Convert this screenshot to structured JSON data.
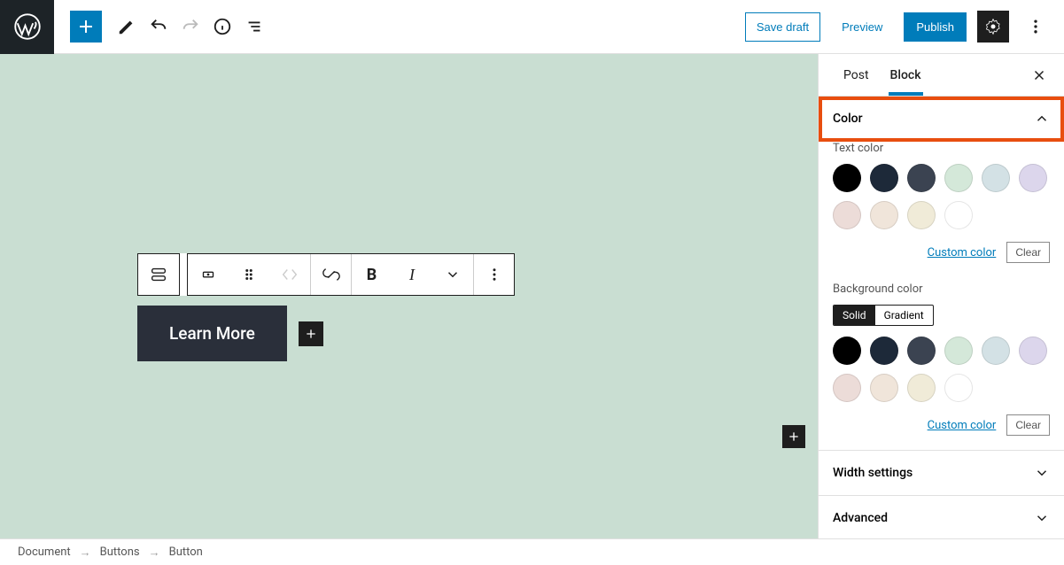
{
  "topbar": {
    "save_draft": "Save draft",
    "preview": "Preview",
    "publish": "Publish"
  },
  "sidebar": {
    "tabs": {
      "post": "Post",
      "block": "Block"
    },
    "panels": {
      "color": {
        "title": "Color",
        "text_label": "Text color",
        "bg_label": "Background color",
        "custom": "Custom color",
        "clear": "Clear",
        "bg_tabs": {
          "solid": "Solid",
          "gradient": "Gradient"
        },
        "swatches": [
          "#000000",
          "#1d2939",
          "#3b4351",
          "#d4e8d9",
          "#d3e1e5",
          "#dcd6ec",
          "#ecdcd8",
          "#f0e5da",
          "#f0ebd8",
          "#ffffff"
        ]
      },
      "width": {
        "title": "Width settings"
      },
      "advanced": {
        "title": "Advanced"
      }
    }
  },
  "canvas": {
    "button_text": "Learn More"
  },
  "breadcrumb": {
    "items": [
      "Document",
      "Buttons",
      "Button"
    ]
  }
}
